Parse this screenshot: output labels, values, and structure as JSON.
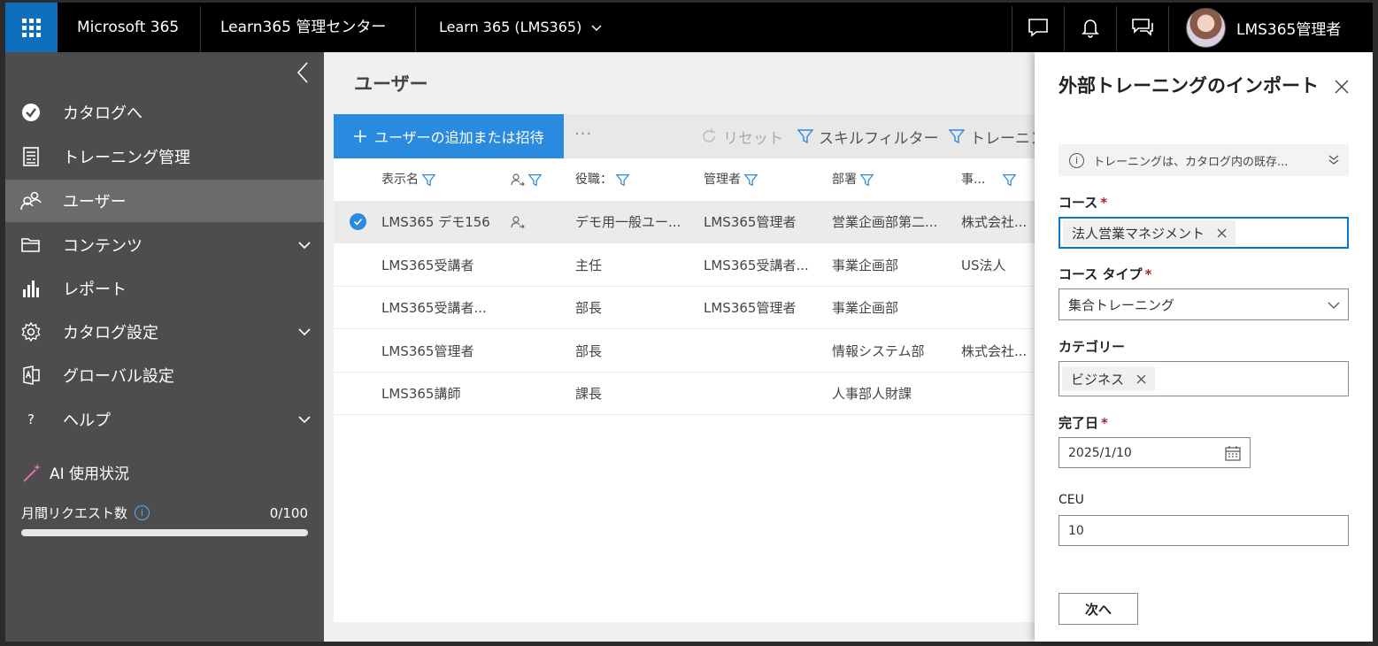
{
  "topbar": {
    "brand": "Microsoft 365",
    "admin_center": "Learn365 管理センター",
    "tenant": "Learn 365 (LMS365)",
    "user_name": "LMS365管理者"
  },
  "sidebar": {
    "items": [
      {
        "label": "カタログへ",
        "icon": "catalog-check-icon"
      },
      {
        "label": "トレーニング管理",
        "icon": "training-doc-icon"
      },
      {
        "label": "ユーザー",
        "icon": "users-icon"
      },
      {
        "label": "コンテンツ",
        "icon": "folder-icon"
      },
      {
        "label": "レポート",
        "icon": "bar-chart-icon"
      },
      {
        "label": "カタログ設定",
        "icon": "gear-icon"
      },
      {
        "label": "グローバル設定",
        "icon": "global-settings-icon"
      },
      {
        "label": "ヘルプ",
        "icon": "help-icon"
      }
    ],
    "ai_title": "AI 使用状況",
    "monthly_requests_label": "月間リクエスト数",
    "monthly_requests_value": "0/100",
    "monthly_requests_fraction": 0
  },
  "main": {
    "title": "ユーザー",
    "toolbar": {
      "add_label": "ユーザーの追加または招待",
      "more_label": "···",
      "reset_label": "リセット",
      "skill_filter_label": "スキルフィルター",
      "training_filter_label": "トレーニン"
    },
    "columns": [
      "表示名",
      "",
      "役職：",
      "管理者",
      "部署",
      "事..."
    ],
    "rows": [
      {
        "name": "LMS365 デモ156",
        "title": "デモ用一般ユー...",
        "manager": "LMS365管理者",
        "dept": "営業企画部第二...",
        "office": "株式会社...",
        "selected": true
      },
      {
        "name": "LMS365受講者",
        "title": "主任",
        "manager": "LMS365受講者...",
        "dept": "事業企画部",
        "office": "US法人",
        "selected": false
      },
      {
        "name": "LMS365受講者...",
        "title": "部長",
        "manager": "LMS365管理者",
        "dept": "事業企画部",
        "office": "",
        "selected": false
      },
      {
        "name": "LMS365管理者",
        "title": "部長",
        "manager": "",
        "dept": "情報システム部",
        "office": "株式会社...",
        "selected": false
      },
      {
        "name": "LMS365講師",
        "title": "課長",
        "manager": "",
        "dept": "人事部人財課",
        "office": "",
        "selected": false
      }
    ]
  },
  "panel": {
    "title": "外部トレーニングのインポート",
    "notice": "トレーニングは、カタログ内の既存...",
    "course_label": "コース",
    "course_value": "法人営業マネジメント",
    "course_type_label": "コース タイプ",
    "course_type_value": "集合トレーニング",
    "category_label": "カテゴリー",
    "category_value": "ビジネス",
    "completion_label": "完了日",
    "completion_value": "2025/1/10",
    "ceu_label": "CEU",
    "ceu_value": "10",
    "required_mark": "*",
    "next_label": "次へ"
  },
  "colors": {
    "accent": "#0078d4",
    "add_button": "#2a8ae0",
    "waffle": "#106ebe",
    "nav_bg": "#4d4d4d",
    "nav_active": "#6b6b6b"
  }
}
